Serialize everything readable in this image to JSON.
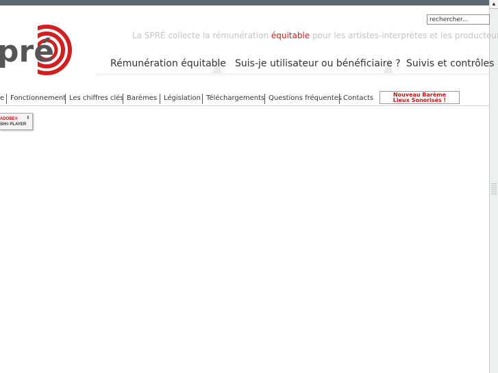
{
  "search": {
    "value": "rechercher..."
  },
  "logo": {
    "text": "pré"
  },
  "tagline": {
    "before": "La SPRÉ collecte la rémunération ",
    "highlight": "équitable",
    "after": " pour les artistes-interprètes et les producteurs."
  },
  "main_nav": [
    {
      "label": "Rémunération équitable"
    },
    {
      "label": "Suis-je utilisateur ou bénéficiaire ?"
    },
    {
      "label": "Suivis et contrôles"
    }
  ],
  "sub_nav": [
    {
      "label": "e"
    },
    {
      "label": "Fonctionnement"
    },
    {
      "label": "Les chiffres clés"
    },
    {
      "label": "Barèmes"
    },
    {
      "label": "Législation"
    },
    {
      "label": "Téléchargements"
    },
    {
      "label": "Questions fréquentes"
    },
    {
      "label": "Contacts"
    }
  ],
  "promo": {
    "line1": "Nouveau Barème",
    "line2": "Lieux Sonorisés !"
  },
  "flash_badge": {
    "line1": "ADOBE®",
    "line2": "SH® PLAYER"
  },
  "colors": {
    "accent": "#d02020",
    "top_bar": "#5a6a6e",
    "tagline": "#c4c4c4"
  },
  "icons": {
    "download": "download-arrow-icon",
    "scroll_up": "arrow-up-icon"
  }
}
